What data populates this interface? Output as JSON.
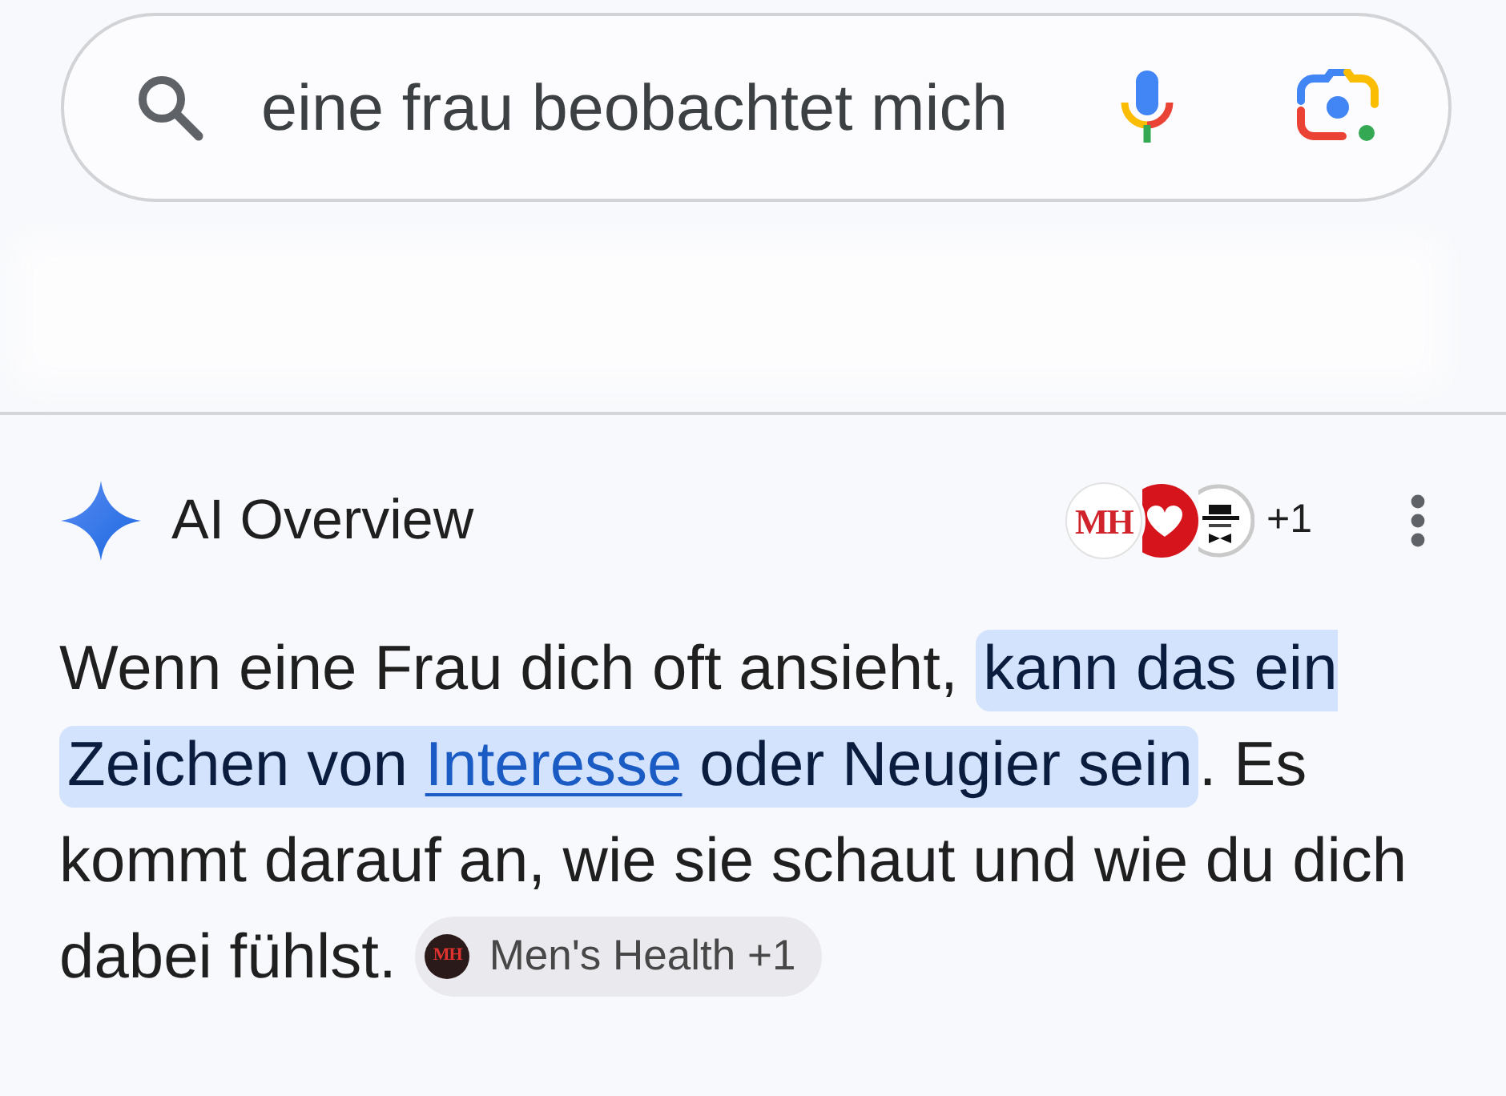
{
  "search": {
    "query": "eine frau beobachtet mich"
  },
  "overview": {
    "title": "AI Overview",
    "sources": [
      {
        "kind": "letters",
        "logo": "MH"
      },
      {
        "kind": "heart"
      },
      {
        "kind": "hat"
      }
    ],
    "more_sources": "+1",
    "paragraph": [
      {
        "text": "Wenn eine Frau dich oft ansieht, ",
        "kind": "text",
        "highlighted": false
      },
      {
        "text": "kann das ein Zeichen von ",
        "kind": "text",
        "highlighted": true
      },
      {
        "text": "Interesse",
        "kind": "link",
        "highlighted": true
      },
      {
        "text": " oder Neugier sein",
        "kind": "text",
        "highlighted": true
      },
      {
        "text": ". Es kommt darauf an, wie sie schaut und wie du dich dabei fühlst.",
        "kind": "text",
        "highlighted": false
      }
    ],
    "citation": {
      "logo": "MH",
      "label": "Men's Health +1"
    }
  }
}
